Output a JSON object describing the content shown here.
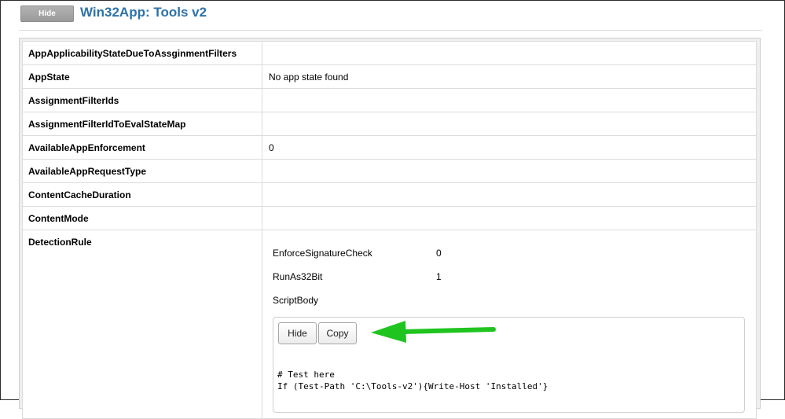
{
  "header": {
    "hide_label": "Hide",
    "title": "Win32App: Tools v2"
  },
  "properties": [
    {
      "key": "AppApplicabilityStateDueToAssginmentFilters",
      "value": ""
    },
    {
      "key": "AppState",
      "value": "No app state found"
    },
    {
      "key": "AssignmentFilterIds",
      "value": ""
    },
    {
      "key": "AssignmentFilterIdToEvalStateMap",
      "value": ""
    },
    {
      "key": "AvailableAppEnforcement",
      "value": "0"
    },
    {
      "key": "AvailableAppRequestType",
      "value": ""
    },
    {
      "key": "ContentCacheDuration",
      "value": ""
    },
    {
      "key": "ContentMode",
      "value": ""
    },
    {
      "key": "DetectionRule",
      "value": ""
    }
  ],
  "detection_rule": {
    "fields": [
      {
        "key": "EnforceSignatureCheck",
        "value": "0"
      },
      {
        "key": "RunAs32Bit",
        "value": "1"
      },
      {
        "key": "ScriptBody",
        "value": ""
      }
    ],
    "script": {
      "hide_label": "Hide",
      "copy_label": "Copy",
      "lines": [
        "# Test here",
        "If (Test-Path 'C:\\Tools-v2'){Write-Host 'Installed'}"
      ]
    }
  },
  "annotation": {
    "arrow_color": "#1fc41f",
    "arrow_direction": "left"
  }
}
